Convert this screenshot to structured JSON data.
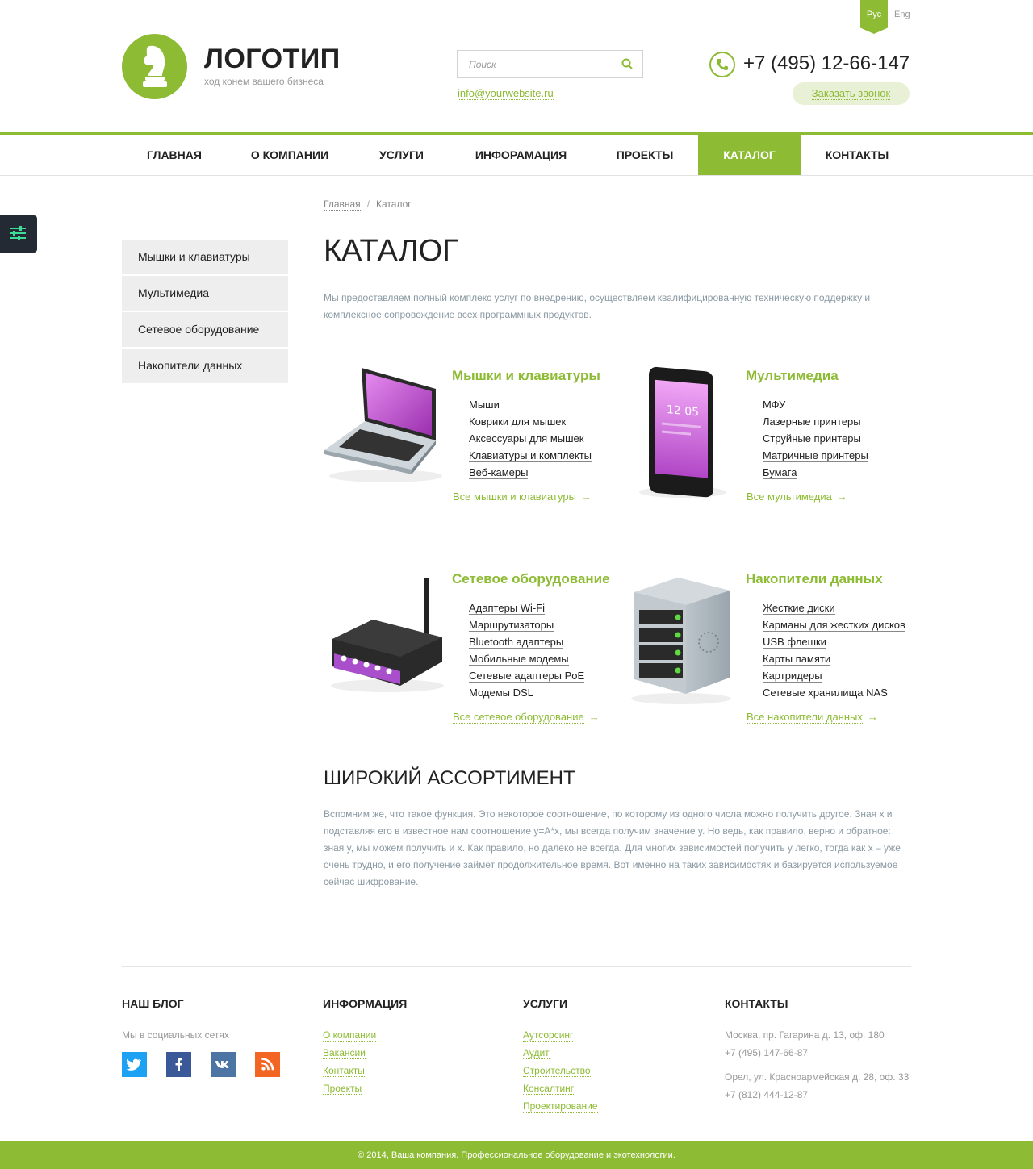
{
  "lang": {
    "active": "Рус",
    "other": "Eng"
  },
  "logo": {
    "title": "ЛОГОТИП",
    "tagline": "ход конем вашего бизнеса"
  },
  "search": {
    "placeholder": "Поиск"
  },
  "contact": {
    "email": "info@yourwebsite.ru",
    "phone": "+7 (495) 12-66-147",
    "callback_label": "Заказать звонок"
  },
  "nav": {
    "items": [
      {
        "label": "ГЛАВНАЯ"
      },
      {
        "label": "О КОМПАНИИ"
      },
      {
        "label": "УСЛУГИ"
      },
      {
        "label": "ИНФОРАМАЦИЯ"
      },
      {
        "label": "ПРОЕКТЫ"
      },
      {
        "label": "КАТАЛОГ"
      },
      {
        "label": "КОНТАКТЫ"
      }
    ],
    "active": "КАТАЛОГ"
  },
  "breadcrumb": {
    "home": "Главная",
    "separator": "/",
    "current": "Каталог"
  },
  "sidebar": {
    "items": [
      {
        "label": "Мышки и клавиатуры"
      },
      {
        "label": "Мультимедиа"
      },
      {
        "label": "Сетевое оборудование"
      },
      {
        "label": "Накопители данных"
      }
    ]
  },
  "page": {
    "title": "КАТАЛОГ",
    "intro": "Мы предоставляем полный комплекс услуг по внедрению, осуществляем квалифицированную техническую поддержку и комплексное сопровождение всех программных продуктов."
  },
  "categories": [
    {
      "title": "Мышки и клавиатуры",
      "icon": "laptop-icon",
      "items": [
        "Мыши",
        "Коврики для мышек",
        "Аксессуары для мышек",
        "Клавиатуры и комплекты",
        "Веб-камеры"
      ],
      "all_link": "Все мышки и клавиатуры",
      "arrow": "→"
    },
    {
      "title": "Мультимедиа",
      "icon": "smartphone-icon",
      "items": [
        "МФУ",
        "Лазерные принтеры",
        "Струйные принтеры",
        "Матричные принтеры",
        "Бумага"
      ],
      "all_link": "Все мультимедиа",
      "arrow": "→"
    },
    {
      "title": "Сетевое оборудование",
      "icon": "router-icon",
      "items": [
        "Адаптеры Wi-Fi",
        "Маршрутизаторы",
        "Bluetooth адаптеры",
        "Мобильные модемы",
        "Сетевые адаптеры PoE",
        "Модемы DSL"
      ],
      "all_link": "Все сетевое оборудование",
      "arrow": "→"
    },
    {
      "title": "Накопители данных",
      "icon": "server-icon",
      "items": [
        "Жесткие диски",
        "Карманы для жестких дисков",
        "USB флешки",
        "Карты памяти",
        "Картридеры",
        "Сетевые хранилища NAS"
      ],
      "all_link": "Все накопители данных",
      "arrow": "→"
    }
  ],
  "assortment": {
    "title": "ШИРОКИЙ АССОРТИМЕНТ",
    "text": "Вспомним же, что такое функция. Это некоторое соотношение, по которому из одного числа можно получить другое. Зная x и подставляя его в известное нам соотношение y=A*x, мы всегда получим значение y. Но ведь, как правило, верно и обратное: зная y, мы можем получить и x. Как правило, но далеко не всегда. Для многих зависимостей получить y легко, тогда как x – уже очень трудно, и его получение займет продолжительное время. Вот именно на таких зависимостях и базируется используемое сейчас шифрование."
  },
  "footer": {
    "blog": {
      "title": "НАШ БЛОГ",
      "text": "Мы в социальных сетях",
      "socials": [
        "twitter-icon",
        "facebook-icon",
        "vk-icon",
        "rss-icon"
      ]
    },
    "info": {
      "title": "ИНФОРМАЦИЯ",
      "links": [
        "О компании",
        "Вакансии",
        "Контакты",
        "Проекты"
      ]
    },
    "services": {
      "title": "УСЛУГИ",
      "links": [
        "Аутсорсинг",
        "Аудит",
        "Строительство",
        "Консалтинг",
        "Проектирование"
      ]
    },
    "contacts": {
      "title": "КОНТАКТЫ",
      "address1": "Москва, пр. Гагарина д. 13, оф. 180",
      "phone1": "+7 (495) 147-66-87",
      "address2": "Орел, ул. Красноармейская д. 28, оф. 33",
      "phone2": "+7 (812) 444-12-87"
    },
    "copyright": "© 2014, Ваша компания. Профессиональное оборудование и экотехнологии."
  },
  "colors": {
    "accent": "#8dbb34",
    "dark": "#232a33",
    "muted": "#8a99a3"
  }
}
